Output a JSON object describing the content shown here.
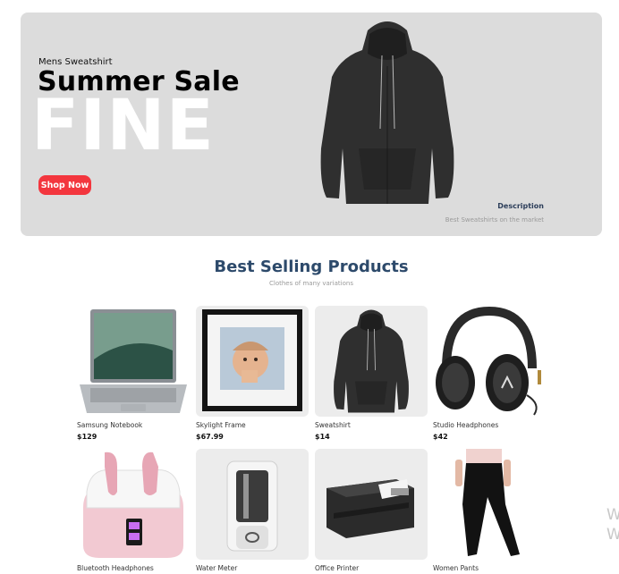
{
  "hero": {
    "subtitle": "Mens Sweatshirt",
    "title": "Summer Sale",
    "big_text": "FINE",
    "button_label": "Shop Now",
    "description_title": "Description",
    "description_text": "Best Sweatshirts on the market",
    "accent_color": "#f3363e"
  },
  "section": {
    "title": "Best Selling Products",
    "subtitle": "Clothes of many variations"
  },
  "products": [
    {
      "name": "Samsung Notebook",
      "price": "$129",
      "icon": "laptop-icon"
    },
    {
      "name": "Skylight Frame",
      "price": "$67.99",
      "icon": "photo-frame-icon"
    },
    {
      "name": "Sweatshirt",
      "price": "$14",
      "icon": "hoodie-icon"
    },
    {
      "name": "Studio Headphones",
      "price": "$42",
      "icon": "headphones-icon"
    },
    {
      "name": "Bluetooth Headphones",
      "price": "",
      "icon": "earbuds-icon"
    },
    {
      "name": "Water Meter",
      "price": "",
      "icon": "water-meter-icon"
    },
    {
      "name": "Office Printer",
      "price": "",
      "icon": "printer-icon"
    },
    {
      "name": "Women Pants",
      "price": "",
      "icon": "pants-icon"
    }
  ],
  "watermark": [
    "W",
    "W"
  ]
}
